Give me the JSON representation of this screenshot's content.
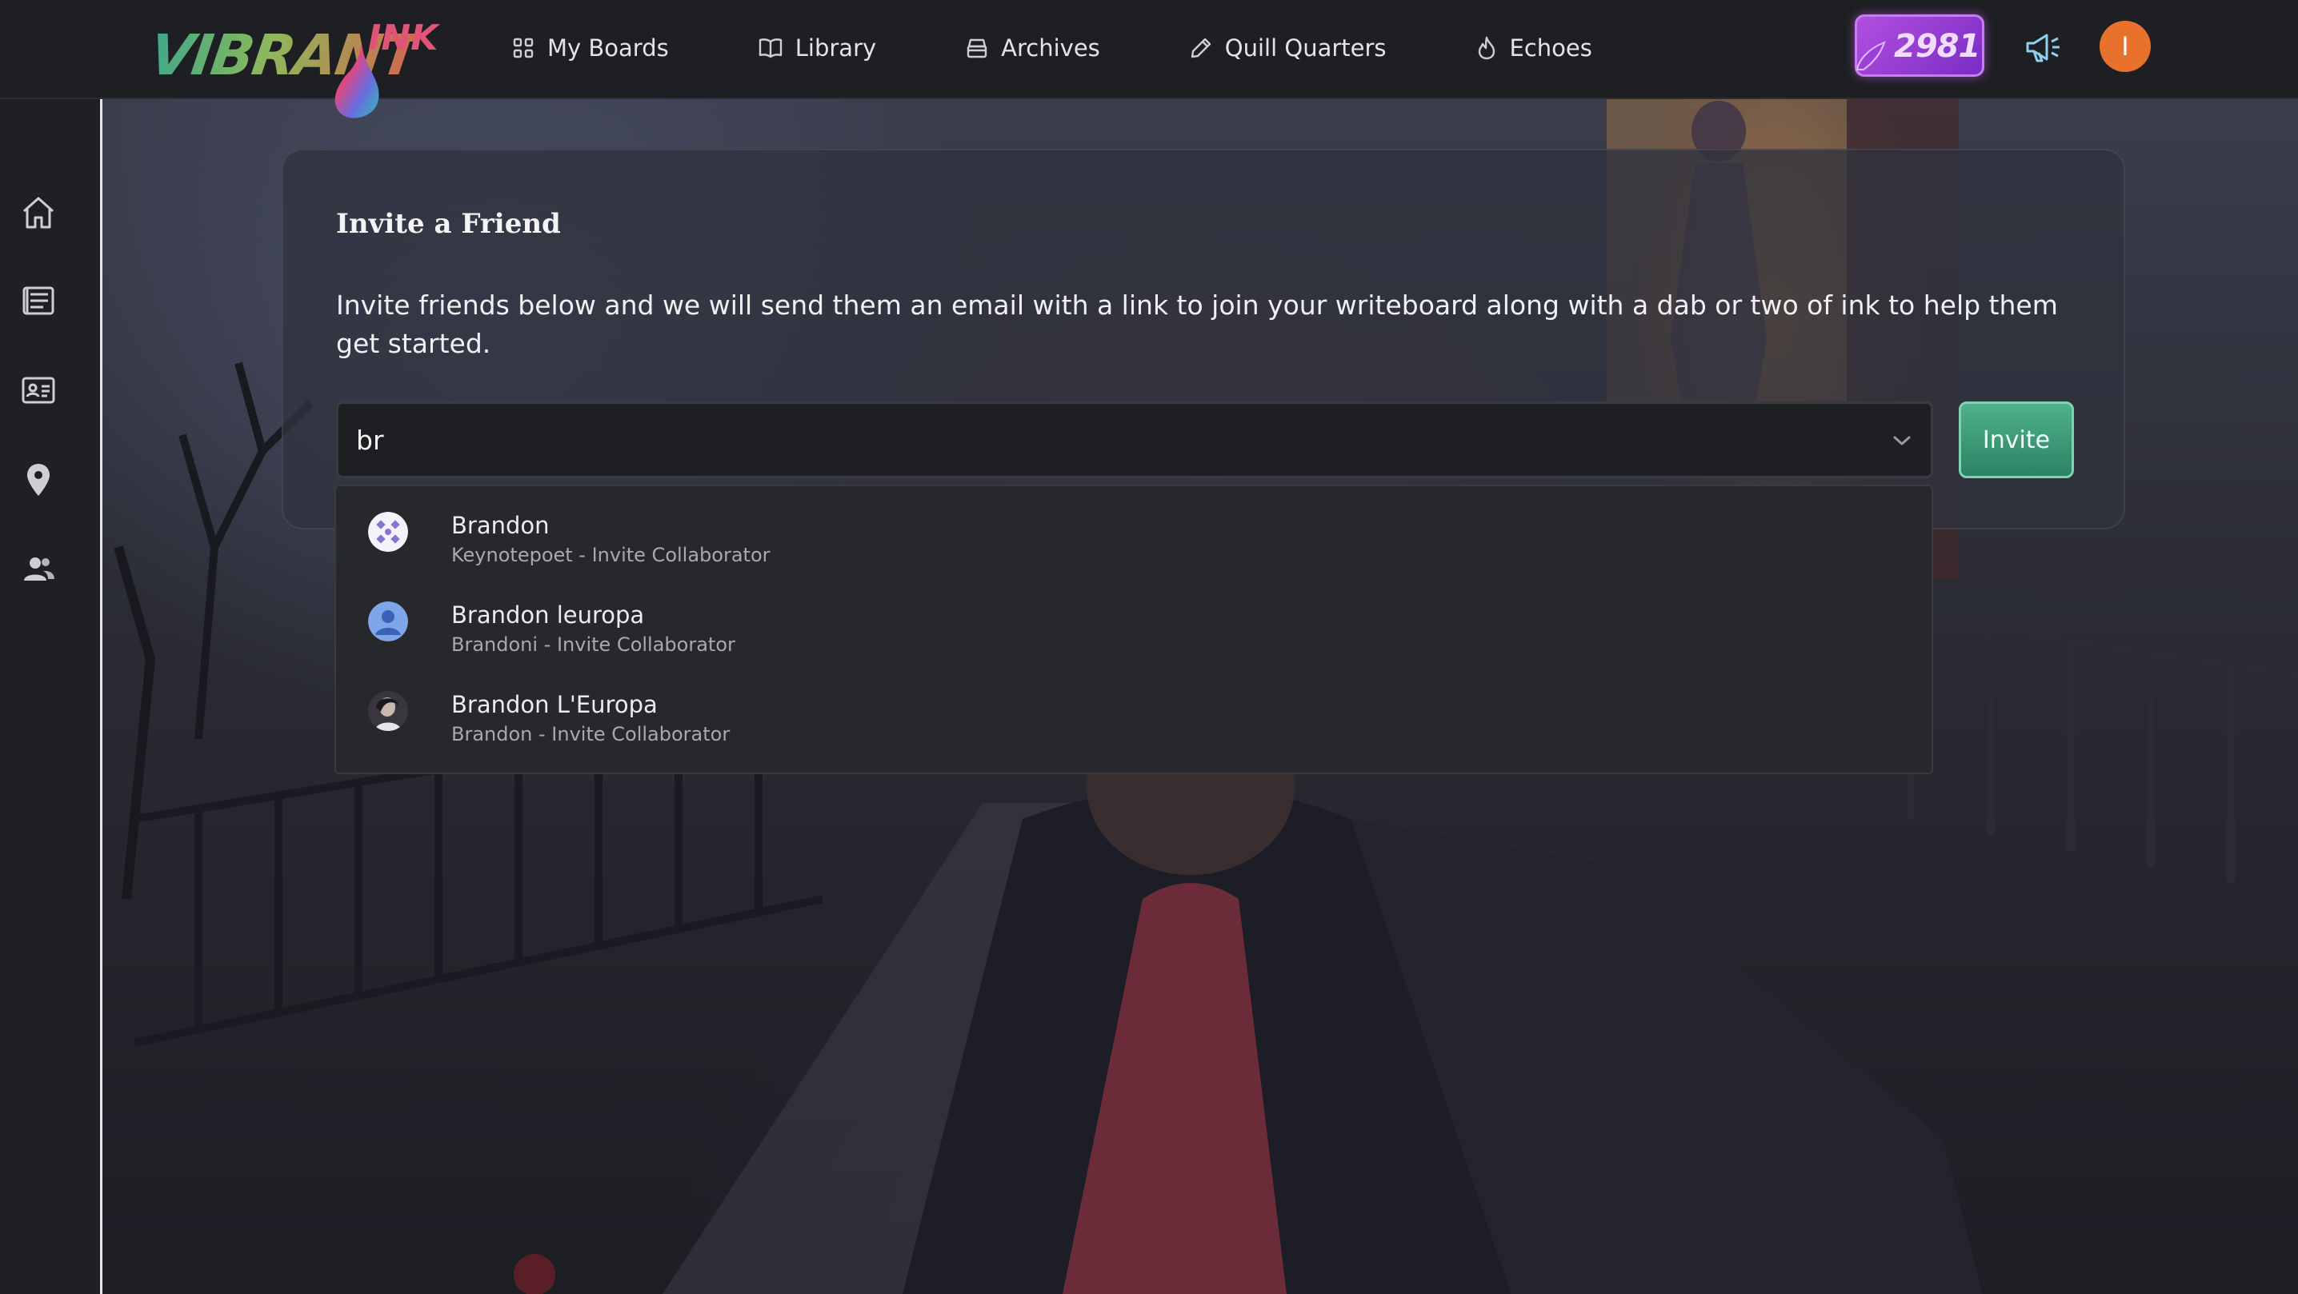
{
  "app": {
    "logo": {
      "main": "VIBRANT",
      "accent": "INK"
    }
  },
  "nav": [
    {
      "label": "My Boards",
      "icon": "grid-icon"
    },
    {
      "label": "Library",
      "icon": "book-icon"
    },
    {
      "label": "Archives",
      "icon": "archive-box-icon"
    },
    {
      "label": "Quill Quarters",
      "icon": "pencil-icon"
    },
    {
      "label": "Echoes",
      "icon": "flame-icon"
    }
  ],
  "header": {
    "ink_count": "2981",
    "avatar_initial": "I",
    "avatar_color": "#e8722c"
  },
  "sidebar": [
    {
      "icon": "home-icon"
    },
    {
      "icon": "notebook-icon"
    },
    {
      "icon": "id-card-icon"
    },
    {
      "icon": "map-pin-icon"
    },
    {
      "icon": "users-add-icon"
    }
  ],
  "invite": {
    "title": "Invite a Friend",
    "description": "Invite friends below and we will send them an email with a link to join your writeboard along with a dab or two of ink to help them get started.",
    "input_value": "br",
    "button_label": "Invite",
    "button_color": "#3a9a78"
  },
  "suggestions": [
    {
      "name": "Brandon",
      "subtitle": "Keynotepoet - Invite Collaborator",
      "avatar": "pattern-avatar"
    },
    {
      "name": "Brandon leuropa",
      "subtitle": "Brandoni - Invite Collaborator",
      "avatar": "default-user-avatar"
    },
    {
      "name": "Brandon L'Europa",
      "subtitle": "Brandon - Invite Collaborator",
      "avatar": "photo-avatar"
    }
  ]
}
